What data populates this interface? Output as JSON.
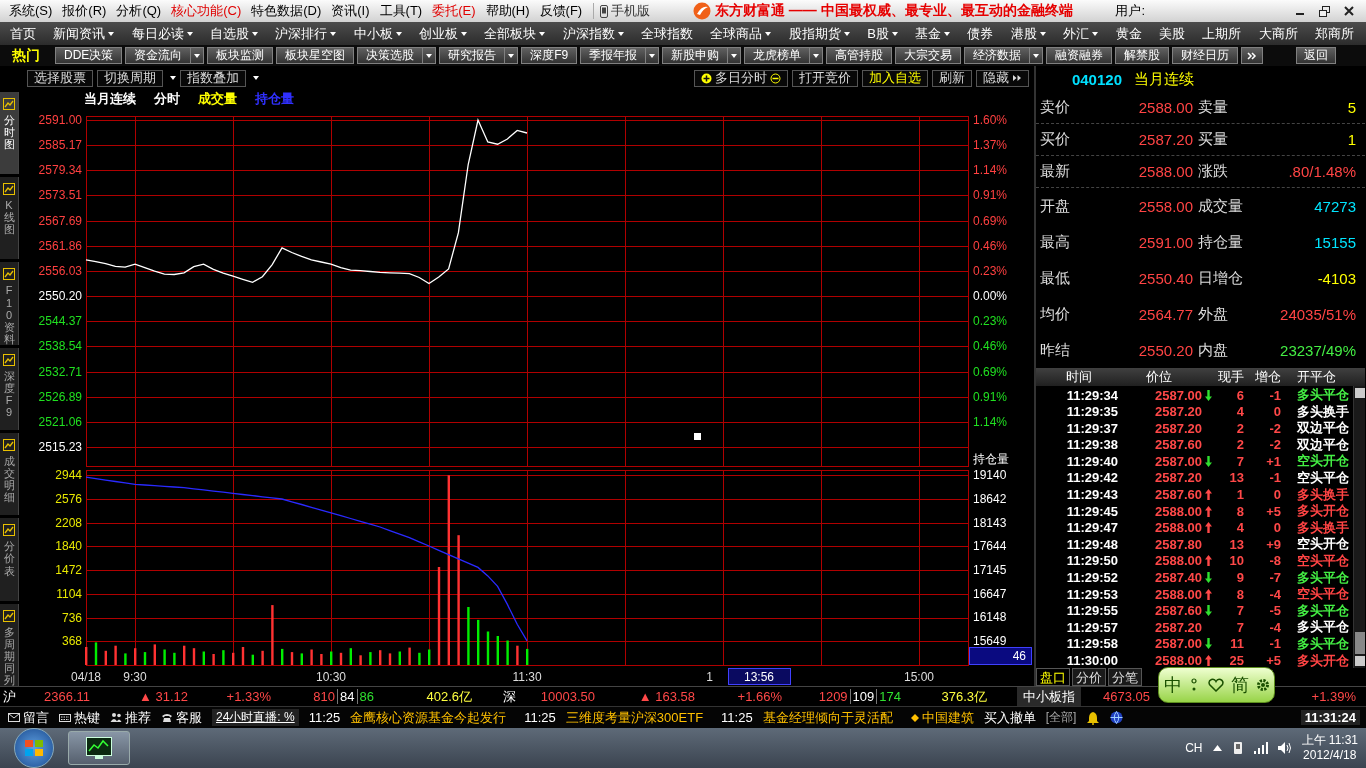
{
  "title_bar": {
    "menus": [
      {
        "label": "系统(S)",
        "color": "#000000"
      },
      {
        "label": "报价(R)",
        "color": "#000000"
      },
      {
        "label": "分析(Q)",
        "color": "#000000"
      },
      {
        "label": "核心功能(C)",
        "color": "#e00000"
      },
      {
        "label": "特色数据(D)",
        "color": "#000000"
      },
      {
        "label": "资讯(I)",
        "color": "#000000"
      },
      {
        "label": "工具(T)",
        "color": "#000000"
      },
      {
        "label": "委托(E)",
        "color": "#e00000"
      },
      {
        "label": "帮助(H)",
        "color": "#000000"
      },
      {
        "label": "反馈(F)",
        "color": "#000000"
      }
    ],
    "mobile_label": "手机版",
    "slogan": "东方财富通 —— 中国最权威、最专业、最互动的金融终端",
    "user_label": "用户:"
  },
  "nav_bar": [
    {
      "label": "首页",
      "has_menu": false
    },
    {
      "label": "新闻资讯",
      "has_menu": true
    },
    {
      "label": "每日必读",
      "has_menu": true
    },
    {
      "label": "自选股",
      "has_menu": true
    },
    {
      "label": "沪深排行",
      "has_menu": true
    },
    {
      "label": "中小板",
      "has_menu": true
    },
    {
      "label": "创业板",
      "has_menu": true
    },
    {
      "label": "全部板块",
      "has_menu": true
    },
    {
      "label": "沪深指数",
      "has_menu": true
    },
    {
      "label": "全球指数",
      "has_menu": false
    },
    {
      "label": "全球商品",
      "has_menu": true
    },
    {
      "label": "股指期货",
      "has_menu": true
    },
    {
      "label": "B股",
      "has_menu": true
    },
    {
      "label": "基金",
      "has_menu": true
    },
    {
      "label": "债券",
      "has_menu": false
    },
    {
      "label": "港股",
      "has_menu": true
    },
    {
      "label": "外汇",
      "has_menu": true
    },
    {
      "label": "黄金",
      "has_menu": false
    },
    {
      "label": "美股",
      "has_menu": false
    },
    {
      "label": "上期所",
      "has_menu": false
    },
    {
      "label": "大商所",
      "has_menu": false
    },
    {
      "label": "郑商所",
      "has_menu": false
    }
  ],
  "toolbar": {
    "hot_label": "热门",
    "buttons": [
      {
        "label": "DDE决策",
        "has_menu": false
      },
      {
        "label": "资金流向",
        "has_menu": true
      },
      {
        "label": "板块监测",
        "has_menu": false
      },
      {
        "label": "板块星空图",
        "has_menu": false
      },
      {
        "label": "决策选股",
        "has_menu": true
      },
      {
        "label": "研究报告",
        "has_menu": true
      },
      {
        "label": "深度F9",
        "has_menu": false
      },
      {
        "label": "季报年报",
        "has_menu": true
      },
      {
        "label": "新股申购",
        "has_menu": true
      },
      {
        "label": "龙虎榜单",
        "has_menu": true
      },
      {
        "label": "高管持股",
        "has_menu": false
      },
      {
        "label": "大宗交易",
        "has_menu": false
      },
      {
        "label": "经济数据",
        "has_menu": true
      },
      {
        "label": "融资融券",
        "has_menu": false
      },
      {
        "label": "解禁股",
        "has_menu": false
      },
      {
        "label": "财经日历",
        "has_menu": false
      }
    ],
    "back_label": "返回"
  },
  "side_tabs": [
    {
      "label": "分时图",
      "selected": true
    },
    {
      "label": "K线图",
      "selected": false
    },
    {
      "label": "F10资料",
      "selected": false
    },
    {
      "label": "深度F9",
      "selected": false
    },
    {
      "label": "成交明细",
      "selected": false
    },
    {
      "label": "分价表",
      "selected": false
    },
    {
      "label": "多周期同列",
      "selected": false
    }
  ],
  "chart_toolbar": {
    "left": [
      {
        "label": "选择股票",
        "has_menu": false
      },
      {
        "label": "切换周期",
        "has_menu": true
      },
      {
        "label": "指数叠加",
        "has_menu": true
      }
    ],
    "right": [
      {
        "label": "多日分时",
        "kind": "stepper",
        "highlighted": false
      },
      {
        "label": "打开竞价",
        "kind": "plain",
        "highlighted": false
      },
      {
        "label": "加入自选",
        "kind": "plain",
        "highlighted": true
      },
      {
        "label": "刷新",
        "kind": "plain",
        "highlighted": false
      },
      {
        "label": "隐藏",
        "kind": "expand",
        "highlighted": false
      }
    ]
  },
  "legend": [
    {
      "label": "当月连续",
      "color": "#ffffff"
    },
    {
      "label": "分时",
      "color": "#ffffff"
    },
    {
      "label": "成交量",
      "color": "#ffff00"
    },
    {
      "label": "持仓量",
      "color": "#3030ff"
    }
  ],
  "price_chart": {
    "chart_data": {
      "type": "line",
      "grid": true,
      "categories": [
        null,
        null,
        null,
        null,
        null,
        null,
        null,
        null,
        null,
        null,
        null,
        null,
        null,
        null,
        null,
        null,
        null,
        null,
        null,
        null,
        null,
        null,
        null,
        null,
        null,
        null,
        null,
        null,
        null,
        null,
        null,
        null,
        null,
        null,
        null,
        null,
        null,
        null,
        null,
        null,
        null,
        null,
        null,
        null,
        null,
        null,
        null,
        null,
        null,
        null,
        null,
        null,
        null,
        null,
        null,
        null,
        null,
        null,
        null,
        null,
        null,
        null,
        null,
        null,
        null,
        null,
        null,
        null,
        null,
        null,
        null,
        null,
        null,
        null,
        null,
        null,
        null,
        null,
        null,
        null,
        null,
        null,
        null,
        null,
        null,
        null,
        null,
        null,
        null,
        null,
        null
      ],
      "series": [
        {
          "color": "#ffffff",
          "values": [
            2558.6,
            2558.2,
            2557.7,
            2557.1,
            2556.9,
            2557.6,
            2556.8,
            2556.0,
            2555.3,
            2555.2,
            2555.6,
            2557.0,
            2557.6,
            2556.4,
            2555.5,
            2554.8,
            2554.1,
            2553.4,
            2554.7,
            2557.5,
            2561.4,
            2560.3,
            2559.4,
            2558.6,
            2558.1,
            2557.6,
            2556.8,
            2556.2,
            2556.1,
            2555.9,
            2555.7,
            2555.6,
            2555.5,
            2555.4,
            2554.5,
            2553.1,
            2554.6,
            2556.5,
            2564.9,
            2580.7,
            2591.0,
            2585.9,
            2585.4,
            2586.6,
            2588.6,
            2588.0,
            null,
            null,
            null,
            null,
            null,
            null,
            null,
            null,
            null,
            null,
            null,
            null,
            null,
            null,
            null,
            null,
            null,
            null,
            null,
            null,
            null,
            null,
            null,
            null,
            null,
            null,
            null,
            null,
            null,
            null,
            null,
            null,
            null,
            null,
            null,
            null,
            null,
            null,
            null,
            null,
            null,
            null,
            null,
            null,
            null
          ]
        }
      ],
      "ylim": [
        2510.83,
        2591.93
      ],
      "yticks": [
        {
          "value": 2591.0,
          "label": "2591.00"
        },
        {
          "value": 2585.17,
          "label": "2585.17"
        },
        {
          "value": 2579.34,
          "label": "2579.34"
        },
        {
          "value": 2573.51,
          "label": "2573.51"
        },
        {
          "value": 2567.69,
          "label": "2567.69"
        },
        {
          "value": 2561.86,
          "label": "2561.86"
        },
        {
          "value": 2556.03,
          "label": "2556.03"
        },
        {
          "value": 2550.2,
          "label": "2550.20"
        },
        {
          "value": 2544.37,
          "label": "2544.37"
        },
        {
          "value": 2538.54,
          "label": "2538.54"
        },
        {
          "value": 2532.71,
          "label": "2532.71"
        },
        {
          "value": 2526.89,
          "label": "2526.89"
        },
        {
          "value": 2521.06,
          "label": "2521.06"
        },
        {
          "value": 2515.23,
          "label": "2515.23"
        }
      ]
    },
    "percent_axis": [
      {
        "label": "1.60%",
        "color": "#ff4040"
      },
      {
        "label": "1.37%",
        "color": "#ff4040"
      },
      {
        "label": "1.14%",
        "color": "#ff4040"
      },
      {
        "label": "0.91%",
        "color": "#ff4040"
      },
      {
        "label": "0.69%",
        "color": "#ff4040"
      },
      {
        "label": "0.46%",
        "color": "#ff4040"
      },
      {
        "label": "0.23%",
        "color": "#ff4040"
      },
      {
        "label": "0.00%",
        "color": "#ffffff"
      },
      {
        "label": "0.23%",
        "color": "#20e020"
      },
      {
        "label": "0.46%",
        "color": "#20e020"
      },
      {
        "label": "0.69%",
        "color": "#20e020"
      },
      {
        "label": "0.91%",
        "color": "#20e020"
      },
      {
        "label": "1.14%",
        "color": "#20e020"
      }
    ]
  },
  "volume_chart": {
    "chart_data": {
      "type": "bar",
      "grid": true,
      "categories": [
        "04/18",
        null,
        null,
        null,
        null,
        "9:30",
        null,
        null,
        null,
        null,
        null,
        null,
        null,
        null,
        null,
        null,
        null,
        null,
        null,
        null,
        null,
        null,
        null,
        null,
        null,
        "10:30",
        null,
        null,
        null,
        null,
        null,
        null,
        null,
        null,
        null,
        null,
        null,
        null,
        null,
        null,
        null,
        null,
        null,
        null,
        null,
        "11:30",
        null,
        null,
        null,
        null,
        null,
        null,
        null,
        null,
        null,
        null,
        null,
        null,
        null,
        null,
        null,
        null,
        null,
        null,
        null,
        null,
        null,
        null,
        null,
        null,
        null,
        null,
        null,
        null,
        null,
        null,
        null,
        null,
        null,
        null,
        null,
        null,
        null,
        null,
        null,
        "15:00",
        null,
        null,
        null,
        null,
        null
      ],
      "series": [
        {
          "color": "#ff3232",
          "values": [
            280,
            null,
            220,
            300,
            null,
            260,
            null,
            320,
            null,
            null,
            300,
            260,
            null,
            170,
            null,
            190,
            280,
            null,
            220,
            930,
            null,
            200,
            null,
            240,
            170,
            null,
            190,
            null,
            150,
            null,
            230,
            180,
            null,
            270,
            null,
            null,
            1520,
            2944,
            2015,
            null,
            null,
            null,
            null,
            null,
            300,
            null,
            null,
            null,
            null,
            null,
            null,
            null,
            null,
            null,
            null,
            null,
            null,
            null,
            null,
            null,
            null,
            null,
            null,
            null,
            null,
            null,
            null,
            null,
            null,
            null,
            null,
            null,
            null,
            null,
            null,
            null,
            null,
            null,
            null,
            null,
            null,
            null,
            null,
            null,
            null,
            null,
            null,
            null,
            null,
            null,
            null
          ]
        },
        {
          "color": "#00ee00",
          "values": [
            null,
            350,
            null,
            null,
            180,
            null,
            200,
            null,
            240,
            190,
            null,
            null,
            210,
            null,
            230,
            null,
            null,
            160,
            null,
            null,
            250,
            null,
            180,
            null,
            null,
            210,
            null,
            260,
            null,
            200,
            null,
            null,
            210,
            null,
            190,
            240,
            null,
            null,
            null,
            900,
            700,
            520,
            450,
            380,
            null,
            250,
            null,
            null,
            null,
            null,
            null,
            null,
            null,
            null,
            null,
            null,
            null,
            null,
            null,
            null,
            null,
            null,
            null,
            null,
            null,
            null,
            null,
            null,
            null,
            null,
            null,
            null,
            null,
            null,
            null,
            null,
            null,
            null,
            null,
            null,
            null,
            null,
            null,
            null,
            null,
            null,
            null,
            null,
            null,
            null,
            null
          ]
        }
      ],
      "ylim": [
        0,
        3026
      ],
      "yticks": [
        {
          "value": 368,
          "label": "368"
        },
        {
          "value": 736,
          "label": "736"
        },
        {
          "value": 1104,
          "label": "1104"
        },
        {
          "value": 1472,
          "label": "1472"
        },
        {
          "value": 1840,
          "label": "1840"
        },
        {
          "value": 2208,
          "label": "2208"
        },
        {
          "value": 2576,
          "label": "2576"
        },
        {
          "value": 2944,
          "label": "2944"
        }
      ]
    },
    "cursor": {
      "marker": "1",
      "time": "13:56",
      "value": "46"
    }
  },
  "open_interest_chart": {
    "chart_data": {
      "type": "line",
      "ylabel": "持仓量",
      "categories": [
        null,
        null,
        null,
        null,
        null,
        null,
        null,
        null,
        null,
        null,
        null,
        null,
        null,
        null,
        null,
        null,
        null,
        null,
        null,
        null,
        null,
        null,
        null,
        null,
        null,
        null,
        null,
        null,
        null,
        null,
        null,
        null,
        null,
        null,
        null,
        null,
        null,
        null,
        null,
        null,
        null,
        null,
        null,
        null,
        null,
        null,
        null,
        null,
        null,
        null,
        null,
        null,
        null,
        null,
        null,
        null,
        null,
        null,
        null,
        null,
        null,
        null,
        null,
        null,
        null,
        null,
        null,
        null,
        null,
        null,
        null,
        null,
        null,
        null,
        null,
        null,
        null,
        null,
        null,
        null,
        null,
        null,
        null,
        null,
        null,
        null,
        null,
        null,
        null,
        null,
        null
      ],
      "series": [
        {
          "color": "#2a2aff",
          "values": [
            19100,
            19070,
            19040,
            19010,
            18980,
            18950,
            18936,
            18922,
            18908,
            18894,
            18880,
            18856,
            18832,
            18808,
            18784,
            18760,
            18736,
            18712,
            18688,
            18664,
            18640,
            18582,
            18524,
            18466,
            18408,
            18350,
            18290,
            18230,
            18170,
            18110,
            18050,
            17975,
            17900,
            17825,
            17740,
            17650,
            17560,
            17470,
            17380,
            17290,
            17200,
            17020,
            16800,
            16420,
            16000,
            15650,
            null,
            null,
            null,
            null,
            null,
            null,
            null,
            null,
            null,
            null,
            null,
            null,
            null,
            null,
            null,
            null,
            null,
            null,
            null,
            null,
            null,
            null,
            null,
            null,
            null,
            null,
            null,
            null,
            null,
            null,
            null,
            null,
            null,
            null,
            null,
            null,
            null,
            null,
            null,
            null,
            null,
            null,
            null,
            null,
            null
          ]
        }
      ],
      "ylim": [
        15143,
        19252
      ],
      "yticks": [
        {
          "value": 15649,
          "label": "15649"
        },
        {
          "value": 16148,
          "label": "16148"
        },
        {
          "value": 16647,
          "label": "16647"
        },
        {
          "value": 17145,
          "label": "17145"
        },
        {
          "value": 17644,
          "label": "17644"
        },
        {
          "value": 18143,
          "label": "18143"
        },
        {
          "value": 18642,
          "label": "18642"
        },
        {
          "value": 19140,
          "label": "19140"
        }
      ]
    }
  },
  "quote": {
    "code": "040120",
    "name": "当月连续",
    "top_rows": [
      {
        "cells": [
          {
            "label": "卖价",
            "value": "2588.00",
            "color": "#ff4444"
          },
          {
            "label": "卖量",
            "value": "5",
            "color": "#ffff00"
          }
        ]
      },
      {
        "cells": [
          {
            "label": "买价",
            "value": "2587.20",
            "color": "#ff4444"
          },
          {
            "label": "买量",
            "value": "1",
            "color": "#ffff00"
          }
        ]
      },
      {
        "cells": [
          {
            "label": "最新",
            "value": "2588.00",
            "color": "#ff4444"
          },
          {
            "label": "涨跌",
            "value": ".80/1.48%",
            "color": "#ff4444"
          }
        ]
      }
    ],
    "rows": [
      {
        "cells": [
          {
            "label": "开盘",
            "value": "2558.00",
            "color": "#ff4444"
          },
          {
            "label": "成交量",
            "value": "47273",
            "color": "#00e5ff"
          }
        ]
      },
      {
        "cells": [
          {
            "label": "最高",
            "value": "2591.00",
            "color": "#ff4444"
          },
          {
            "label": "持仓量",
            "value": "15155",
            "color": "#00e5ff"
          }
        ]
      },
      {
        "cells": [
          {
            "label": "最低",
            "value": "2550.40",
            "color": "#ff4444"
          },
          {
            "label": "日增仓",
            "value": "-4103",
            "color": "#ffff00"
          }
        ]
      },
      {
        "cells": [
          {
            "label": "均价",
            "value": "2564.77",
            "color": "#ff4444"
          },
          {
            "label": "外盘",
            "value": "24035/51%",
            "color": "#ff4444"
          }
        ]
      },
      {
        "cells": [
          {
            "label": "昨结",
            "value": "2550.20",
            "color": "#ff4444"
          },
          {
            "label": "内盘",
            "value": "23237/49%",
            "color": "#44ee44"
          }
        ]
      }
    ]
  },
  "trades": {
    "columns": [
      "时间",
      "价位",
      "现手",
      "增仓",
      "开平仓"
    ],
    "rows": [
      {
        "time": "11:29:34",
        "price": "2587.00",
        "kind": "down",
        "volume": "6",
        "change": "-1",
        "type": "多头平仓",
        "color": "#44ee44"
      },
      {
        "time": "11:29:35",
        "price": "2587.20",
        "kind": "flat",
        "volume": "4",
        "change": "0",
        "type": "多头换手",
        "color": "#ffffff"
      },
      {
        "time": "11:29:37",
        "price": "2587.20",
        "kind": "flat",
        "volume": "2",
        "change": "-2",
        "type": "双边平仓",
        "color": "#ffffff"
      },
      {
        "time": "11:29:38",
        "price": "2587.60",
        "kind": "flat",
        "volume": "2",
        "change": "-2",
        "type": "双边平仓",
        "color": "#ffffff"
      },
      {
        "time": "11:29:40",
        "price": "2587.00",
        "kind": "down",
        "volume": "7",
        "change": "+1",
        "type": "空头开仓",
        "color": "#44ee44"
      },
      {
        "time": "11:29:42",
        "price": "2587.20",
        "kind": "flat",
        "volume": "13",
        "change": "-1",
        "type": "空头平仓",
        "color": "#ffffff"
      },
      {
        "time": "11:29:43",
        "price": "2587.60",
        "kind": "up",
        "volume": "1",
        "change": "0",
        "type": "多头换手",
        "color": "#ff4444"
      },
      {
        "time": "11:29:45",
        "price": "2588.00",
        "kind": "up",
        "volume": "8",
        "change": "+5",
        "type": "多头开仓",
        "color": "#ff4444"
      },
      {
        "time": "11:29:47",
        "price": "2588.00",
        "kind": "up",
        "volume": "4",
        "change": "0",
        "type": "多头换手",
        "color": "#ff4444"
      },
      {
        "time": "11:29:48",
        "price": "2587.80",
        "kind": "flat",
        "volume": "13",
        "change": "+9",
        "type": "空头开仓",
        "color": "#ffffff"
      },
      {
        "time": "11:29:50",
        "price": "2588.00",
        "kind": "up",
        "volume": "10",
        "change": "-8",
        "type": "空头平仓",
        "color": "#ff4444"
      },
      {
        "time": "11:29:52",
        "price": "2587.40",
        "kind": "down",
        "volume": "9",
        "change": "-7",
        "type": "多头平仓",
        "color": "#44ee44"
      },
      {
        "time": "11:29:53",
        "price": "2588.00",
        "kind": "up",
        "volume": "8",
        "change": "-4",
        "type": "空头平仓",
        "color": "#ff4444"
      },
      {
        "time": "11:29:55",
        "price": "2587.60",
        "kind": "down",
        "volume": "7",
        "change": "-5",
        "type": "多头平仓",
        "color": "#44ee44"
      },
      {
        "time": "11:29:57",
        "price": "2587.20",
        "kind": "flat",
        "volume": "7",
        "change": "-4",
        "type": "多头平仓",
        "color": "#ffffff"
      },
      {
        "time": "11:29:58",
        "price": "2587.00",
        "kind": "down",
        "volume": "11",
        "change": "-1",
        "type": "多头平仓",
        "color": "#44ee44"
      },
      {
        "time": "11:30:00",
        "price": "2588.00",
        "kind": "up",
        "volume": "25",
        "change": "+5",
        "type": "多头开仓",
        "color": "#ff4444"
      }
    ],
    "tabs": [
      {
        "label": "盘口",
        "selected": true
      },
      {
        "label": "分价",
        "selected": false
      },
      {
        "label": "分笔",
        "selected": false
      }
    ]
  },
  "index_bar": [
    {
      "market": "沪",
      "price": "2366.11",
      "change": "▲ 31.12",
      "percent": "+1.33%",
      "counts": [
        "810",
        "84",
        "86"
      ],
      "amount": "402.6亿"
    },
    {
      "market": "深",
      "price": "10003.50",
      "change": "▲ 163.58",
      "percent": "+1.66%",
      "counts": [
        "1209",
        "109",
        "174"
      ],
      "amount": "376.3亿"
    },
    {
      "market": "中小板指",
      "price": "4673.05",
      "percent": "+1.39%"
    }
  ],
  "ticker": {
    "shortcuts": [
      {
        "kind": "message",
        "label": "留言"
      },
      {
        "kind": "keyboard",
        "label": "热键"
      },
      {
        "kind": "people",
        "label": "推荐"
      },
      {
        "kind": "phone",
        "label": "客服"
      }
    ],
    "live_label": "24小时直播: %",
    "news": [
      {
        "time": "11:25",
        "headline": "金鹰核心资源基金今起发行"
      },
      {
        "time": "11:25",
        "headline": "三维度考量沪深300ETF"
      },
      {
        "time": "11:25",
        "headline": "基金经理倾向于灵活配"
      }
    ],
    "stock": "中国建筑",
    "action": "买入撤单",
    "filter": "[全部]",
    "clock": "11:31:24"
  },
  "ime_toolbar": {
    "mode": "中",
    "charset": "简"
  },
  "taskbar": {
    "language": "CH",
    "time": "上午 11:31",
    "date": "2012/4/18"
  }
}
